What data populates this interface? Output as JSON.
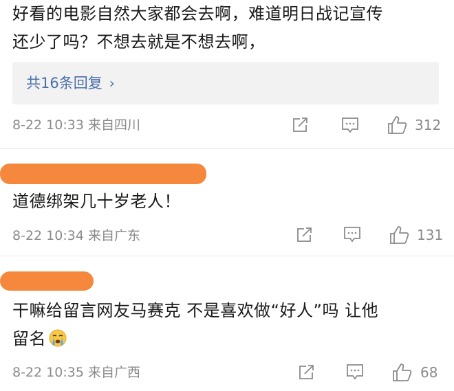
{
  "comment1": {
    "text_line1": "好看的电影自然大家都会去啊，难道明日战记宣传",
    "text_line2": "还少了吗？不想去就是不想去啊，",
    "reply_label": "共16条回复",
    "reply_chevron": "›",
    "meta": "8-22 10:33 来自四川",
    "like_count": "312"
  },
  "comment2": {
    "text": "道德绑架几十岁老人！",
    "meta": "8-22 10:34 来自广东",
    "like_count": "131"
  },
  "comment3": {
    "text_line1": "干嘛给留言网友马赛克 不是喜欢做“好人”吗 让他",
    "text_line2": "留名",
    "emoji": "crying-face-emoji",
    "meta": "8-22 10:35 来自广西",
    "like_count": "68"
  },
  "icons": {
    "share": "share-icon",
    "comment": "comment-icon",
    "like": "thumbs-up-icon"
  },
  "colors": {
    "link": "#4a6ea9",
    "meta": "#8a8a8a",
    "redaction": "#f5883c"
  }
}
